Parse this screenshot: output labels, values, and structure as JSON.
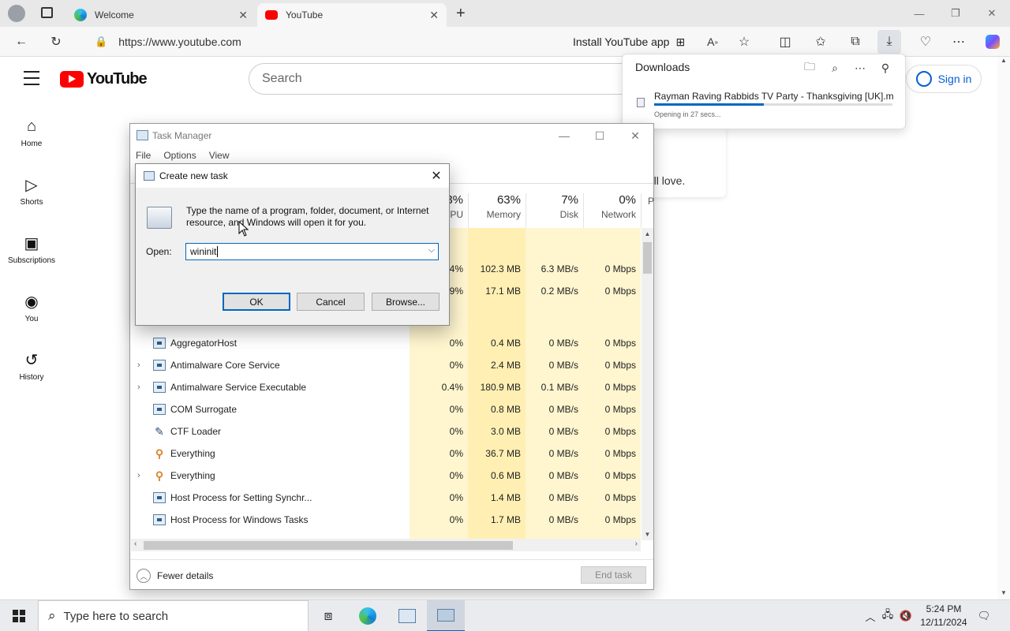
{
  "browser": {
    "tabs": [
      {
        "label": "Welcome",
        "icon": "edge-icon"
      },
      {
        "label": "YouTube",
        "icon": "youtube-icon"
      }
    ],
    "url": "https://www.youtube.com",
    "install_label": "Install YouTube app"
  },
  "youtube": {
    "logo_text": "YouTube",
    "search_placeholder": "Search",
    "signin_label": "Sign in",
    "nav": [
      {
        "label": "Home",
        "icon": "home-icon"
      },
      {
        "label": "Shorts",
        "icon": "shorts-icon"
      },
      {
        "label": "Subscriptions",
        "icon": "subscriptions-icon"
      },
      {
        "label": "You",
        "icon": "you-icon"
      },
      {
        "label": "History",
        "icon": "history-icon"
      }
    ],
    "card_text": "'ll love."
  },
  "downloads": {
    "title": "Downloads",
    "item_name": "Rayman Raving Rabbids TV Party - Thanksgiving [UK].m...",
    "item_status": "Opening in 27 secs...",
    "progress_fraction": 0.46
  },
  "task_manager": {
    "title": "Task Manager",
    "menu": [
      "File",
      "Options",
      "View"
    ],
    "columns": [
      {
        "pct": "3%",
        "label": "PU"
      },
      {
        "pct": "63%",
        "label": "Memory"
      },
      {
        "pct": "7%",
        "label": "Disk"
      },
      {
        "pct": "0%",
        "label": "Network"
      },
      {
        "pct": "",
        "label": "P"
      }
    ],
    "partial_rows": [
      {
        "cpu": ".4%",
        "memory": "102.3 MB",
        "disk": "6.3 MB/s",
        "network": "0 Mbps"
      },
      {
        "cpu": ".9%",
        "memory": "17.1 MB",
        "disk": "0.2 MB/s",
        "network": "0 Mbps"
      }
    ],
    "rows": [
      {
        "name": "AggregatorHost",
        "expand": false,
        "icon": "process-icon",
        "cpu": "0%",
        "memory": "0.4 MB",
        "disk": "0 MB/s",
        "network": "0 Mbps"
      },
      {
        "name": "Antimalware Core Service",
        "expand": true,
        "icon": "process-icon",
        "cpu": "0%",
        "memory": "2.4 MB",
        "disk": "0 MB/s",
        "network": "0 Mbps"
      },
      {
        "name": "Antimalware Service Executable",
        "expand": true,
        "icon": "process-icon",
        "cpu": "0.4%",
        "memory": "180.9 MB",
        "disk": "0.1 MB/s",
        "network": "0 Mbps"
      },
      {
        "name": "COM Surrogate",
        "expand": false,
        "icon": "process-icon",
        "cpu": "0%",
        "memory": "0.8 MB",
        "disk": "0 MB/s",
        "network": "0 Mbps"
      },
      {
        "name": "CTF Loader",
        "expand": false,
        "icon": "ctf-loader-icon",
        "cpu": "0%",
        "memory": "3.0 MB",
        "disk": "0 MB/s",
        "network": "0 Mbps"
      },
      {
        "name": "Everything",
        "expand": false,
        "icon": "magnifier-icon",
        "cpu": "0%",
        "memory": "36.7 MB",
        "disk": "0 MB/s",
        "network": "0 Mbps"
      },
      {
        "name": "Everything",
        "expand": true,
        "icon": "magnifier-icon",
        "cpu": "0%",
        "memory": "0.6 MB",
        "disk": "0 MB/s",
        "network": "0 Mbps"
      },
      {
        "name": "Host Process for Setting Synchr...",
        "expand": false,
        "icon": "process-icon",
        "cpu": "0%",
        "memory": "1.4 MB",
        "disk": "0 MB/s",
        "network": "0 Mbps"
      },
      {
        "name": "Host Process for Windows Tasks",
        "expand": false,
        "icon": "process-icon",
        "cpu": "0%",
        "memory": "1.7 MB",
        "disk": "0 MB/s",
        "network": "0 Mbps"
      }
    ],
    "fewer_details": "Fewer details",
    "end_task": "End task"
  },
  "run_dialog": {
    "title": "Create new task",
    "description": "Type the name of a program, folder, document, or Internet resource, and Windows will open it for you.",
    "open_label": "Open:",
    "open_value": "wininit",
    "ok": "OK",
    "cancel": "Cancel",
    "browse": "Browse..."
  },
  "taskbar": {
    "search_placeholder": "Type here to search",
    "time": "5:24 PM",
    "date": "12/11/2024"
  },
  "colors": {
    "youtube_red": "#ff0000",
    "accent": "#0067c0",
    "highlight_cell": "#fff4c4",
    "highlight_cell_strong": "#ffe9a8"
  }
}
